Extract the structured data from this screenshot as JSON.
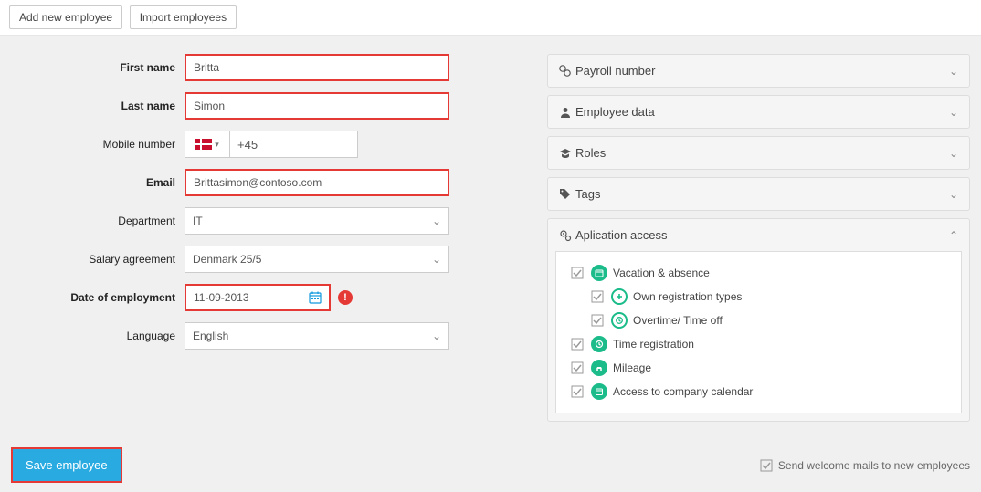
{
  "topButtons": {
    "addNew": "Add new employee",
    "import": "Import employees"
  },
  "form": {
    "labels": {
      "firstName": "First name",
      "lastName": "Last name",
      "mobile": "Mobile number",
      "email": "Email",
      "department": "Department",
      "salary": "Salary agreement",
      "doe": "Date of employment",
      "language": "Language"
    },
    "values": {
      "firstName": "Britta",
      "lastName": "Simon",
      "phonePrefix": "+45",
      "email": "Brittasimon@contoso.com",
      "department": "IT",
      "salary": "Denmark 25/5",
      "doe": "11-09-2013",
      "language": "English"
    }
  },
  "panels": {
    "payroll": "Payroll number",
    "employeeData": "Employee data",
    "roles": "Roles",
    "tags": "Tags",
    "appAccess": "Aplication access"
  },
  "access": {
    "vacation": "Vacation & absence",
    "ownReg": "Own registration types",
    "overtime": "Overtime/ Time off",
    "timeReg": "Time registration",
    "mileage": "Mileage",
    "calendar": "Access to company calendar"
  },
  "footer": {
    "save": "Save employee",
    "welcomeMail": "Send welcome mails to new employees"
  }
}
